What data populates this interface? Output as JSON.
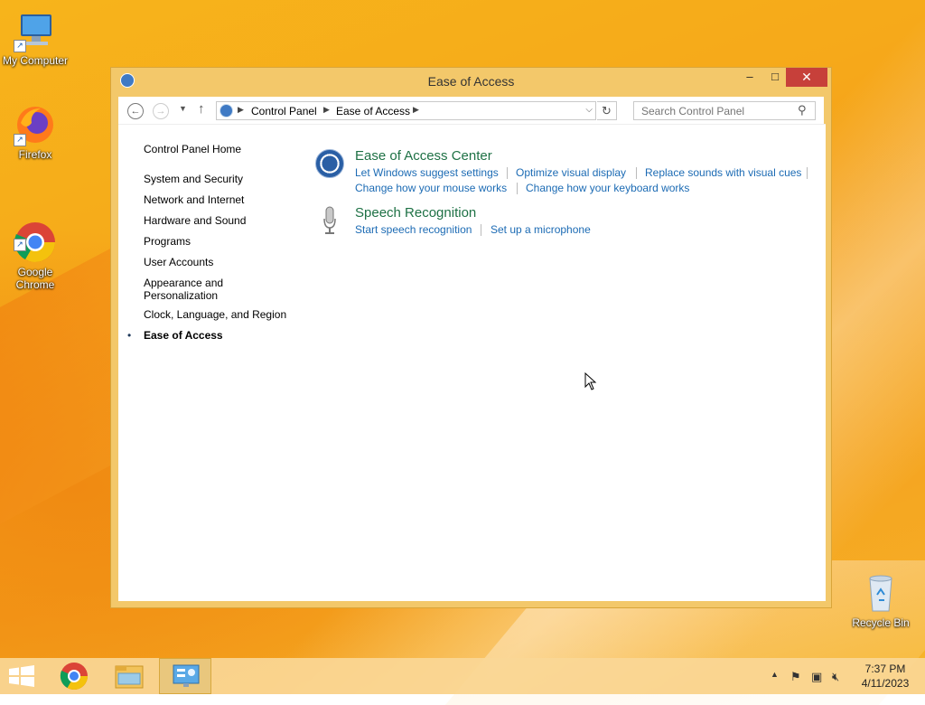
{
  "desktop": {
    "icons": [
      {
        "label": "My Computer"
      },
      {
        "label": "Firefox"
      },
      {
        "label": "Google\nChrome"
      },
      {
        "label": "Recycle Bin"
      }
    ]
  },
  "window": {
    "title": "Ease of Access",
    "buttons": {
      "minimize": "–",
      "maximize": "□",
      "close": "✕"
    },
    "address": {
      "crumbs": [
        "Control Panel",
        "Ease of Access"
      ]
    },
    "search": {
      "placeholder": "Search Control Panel"
    }
  },
  "leftnav": {
    "home": "Control Panel Home",
    "items": [
      "System and Security",
      "Network and Internet",
      "Hardware and Sound",
      "Programs",
      "User Accounts",
      "Appearance and Personalization",
      "Clock, Language, and Region",
      "Ease of Access"
    ],
    "active": "Ease of Access"
  },
  "groups": [
    {
      "title": "Ease of Access Center",
      "links": [
        "Let Windows suggest settings",
        "Optimize visual display",
        "Replace sounds with visual cues",
        "Change how your mouse works",
        "Change how your keyboard works"
      ]
    },
    {
      "title": "Speech Recognition",
      "links": [
        "Start speech recognition",
        "Set up a microphone"
      ]
    }
  ],
  "taskbar": {
    "clock": {
      "time": "7:37 PM",
      "date": "4/11/2023"
    }
  }
}
